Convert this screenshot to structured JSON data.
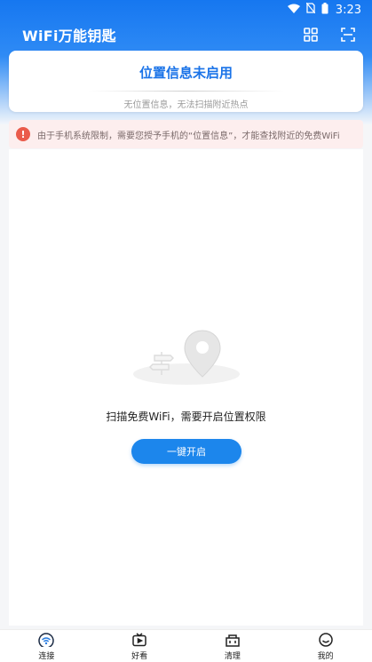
{
  "status_bar": {
    "time": "3:23"
  },
  "app": {
    "title": "WiFi万能钥匙"
  },
  "notice": {
    "title": "位置信息未启用",
    "subtitle": "无位置信息，无法扫描附近热点"
  },
  "warning": {
    "icon_glyph": "!",
    "text": "由于手机系统限制，需要您授予手机的“位置信息”，才能查找附近的免费WiFi"
  },
  "empty_state": {
    "message": "扫描免费WiFi，需要开启位置权限",
    "button_label": "一键开启"
  },
  "bottom_nav": {
    "items": [
      {
        "label": "连接",
        "icon": "wifi-icon"
      },
      {
        "label": "好看",
        "icon": "tv-icon"
      },
      {
        "label": "清理",
        "icon": "clean-icon"
      },
      {
        "label": "我的",
        "icon": "smile-icon"
      }
    ]
  },
  "colors": {
    "brand": "#1677f0",
    "accent": "#1c86ec",
    "warning": "#ea5b4b"
  }
}
